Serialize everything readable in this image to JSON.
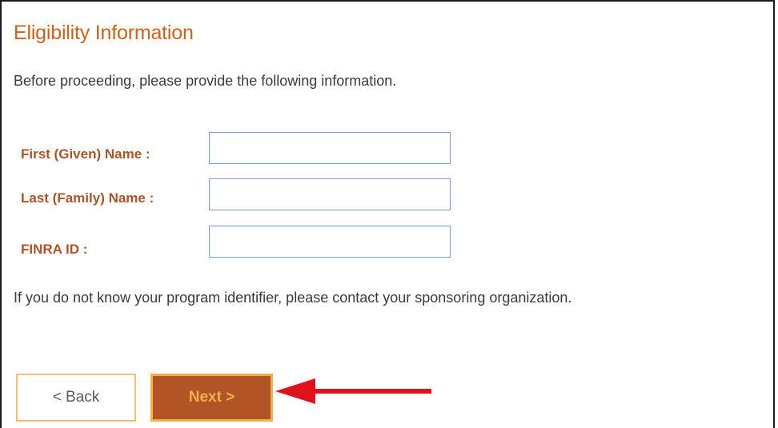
{
  "form": {
    "title": "Eligibility Information",
    "intro": "Before proceeding, please provide the following information.",
    "fields": [
      {
        "label": "First (Given) Name :",
        "value": "",
        "placeholder": ""
      },
      {
        "label": "Last (Family) Name :",
        "value": "",
        "placeholder": ""
      },
      {
        "label": "FINRA ID :",
        "value": "",
        "placeholder": ""
      }
    ],
    "note": "If you do not know your program identifier, please contact your sponsoring organization."
  },
  "buttons": {
    "back_label": "< Back",
    "next_label": "Next >"
  },
  "annotation": {
    "icon": "left-pointing-arrow-icon",
    "color": "#e0121b"
  },
  "colors": {
    "title": "#c8641e",
    "label": "#a9542a",
    "next_button_bg": "#b35426",
    "next_button_text": "#f2b04a",
    "input_border": "#7fa0c8"
  }
}
